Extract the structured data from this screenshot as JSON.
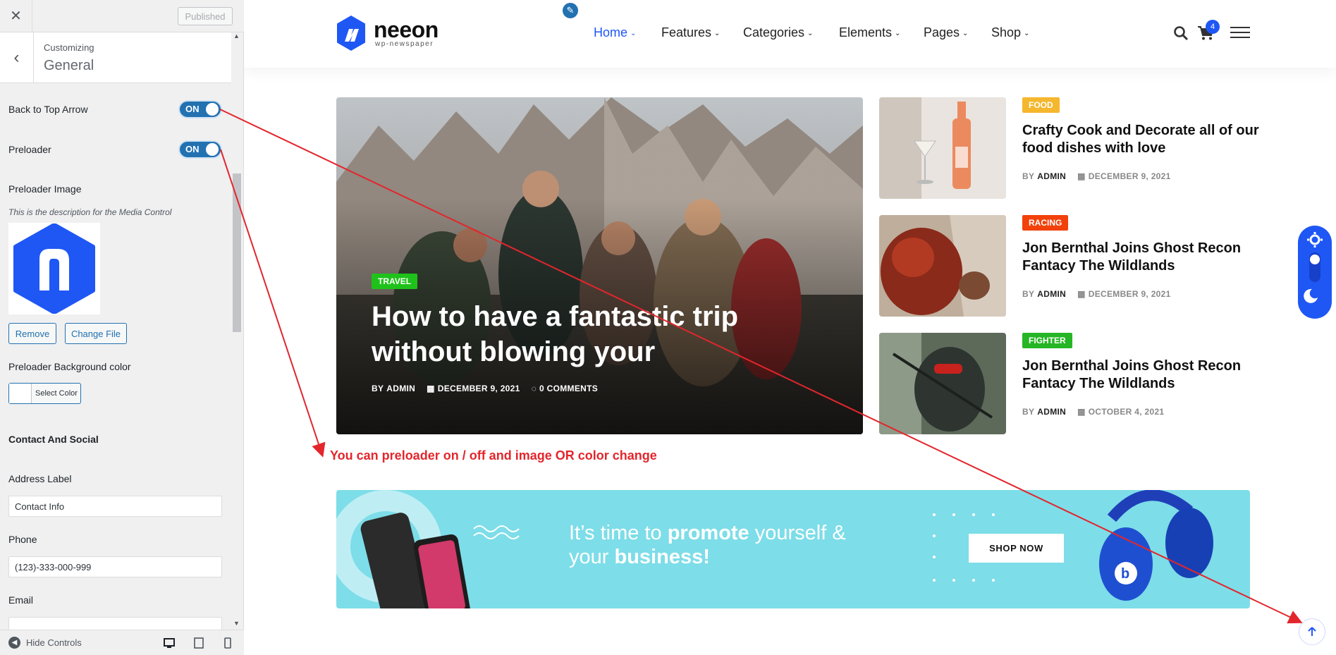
{
  "sidebar": {
    "published_label": "Published",
    "customizing_label": "Customizing",
    "section_title": "General",
    "back_to_top_label": "Back to Top Arrow",
    "back_to_top_state": "ON",
    "preloader_label": "Preloader",
    "preloader_state": "ON",
    "preloader_image_label": "Preloader Image",
    "media_description": "This is the description for the Media Control",
    "remove_label": "Remove",
    "change_file_label": "Change File",
    "preloader_bg_label": "Preloader Background color",
    "select_color_label": "Select Color",
    "contact_social_label": "Contact And Social",
    "address_label": "Address Label",
    "address_value": "Contact Info",
    "phone_label": "Phone",
    "phone_value": "(123)-333-000-999",
    "email_label": "Email",
    "hide_controls_label": "Hide Controls"
  },
  "site": {
    "logo_name": "neeon",
    "logo_sub": "wp-newspaper",
    "nav": [
      "Home",
      "Features",
      "Categories",
      "Elements",
      "Pages",
      "Shop"
    ],
    "active_nav": "Home",
    "cart_count": "4"
  },
  "hero": {
    "category": "TRAVEL",
    "title": "How to have a fantastic trip without blowing your",
    "by": "BY",
    "author": "ADMIN",
    "date": "DECEMBER 9, 2021",
    "comments": "0 COMMENTS"
  },
  "side_posts": [
    {
      "category": "FOOD",
      "title": "Crafty Cook and Decorate all of our food dishes with love",
      "by": "BY",
      "author": "ADMIN",
      "date": "DECEMBER 9, 2021"
    },
    {
      "category": "RACING",
      "title": "Jon Bernthal Joins Ghost Recon Fantacy The Wildlands",
      "by": "BY",
      "author": "ADMIN",
      "date": "DECEMBER 9, 2021"
    },
    {
      "category": "FIGHTER",
      "title": "Jon Bernthal Joins Ghost Recon Fantacy The Wildlands",
      "by": "BY",
      "author": "ADMIN",
      "date": "OCTOBER 4, 2021"
    }
  ],
  "annotation": "You can preloader on / off and image OR color change",
  "ad": {
    "line1_a": "It’s time to ",
    "line1_b": "promote",
    "line1_c": " yourself &",
    "line2_a": "your ",
    "line2_b": "business!",
    "button": "SHOP NOW"
  },
  "colors": {
    "accent": "#1f57f5",
    "toggle": "#2271b1",
    "food": "#f5b72d",
    "racing": "#f2410a",
    "fighter": "#26b524",
    "travel": "#1fc21a",
    "annotation": "#e3262c",
    "ad_bg": "#7ddde8"
  }
}
